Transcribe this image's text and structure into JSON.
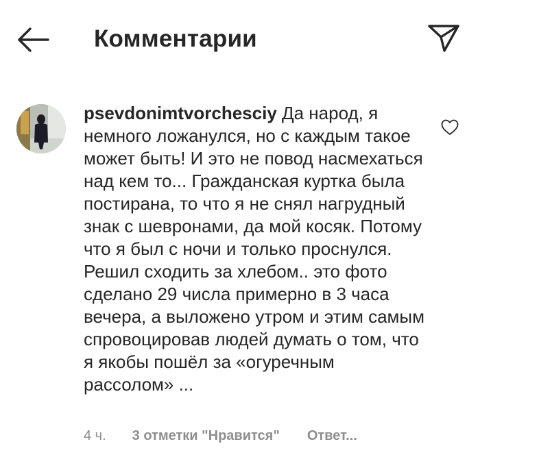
{
  "header": {
    "back_icon": "arrow-left-icon",
    "title": "Комментарии",
    "share_icon": "paper-plane-icon"
  },
  "comment": {
    "username": "psevdonimtvorchesciy",
    "text": "Да народ, я немного ложанулся, но с каждым такое может быть! И это не повод насмехаться над кем то... Гражданская куртка была постирана, то что я не снял нагрудный знак с шевронами, да мой косяк. Потому что я был с ночи и только проснулся. Решил сходить за хлебом.. это фото сделано 29 числа примерно в 3 часа вечера, а выложено утром и этим самым спровоцировав людей думать о том, что я якобы пошёл за «огуречным рассолом» ...",
    "time": "4 ч.",
    "likes": "3 отметки \"Нравится\"",
    "reply": "Ответ...",
    "like_icon": "heart-outline-icon"
  },
  "colors": {
    "text": "#262626",
    "secondary": "#8e8e8e",
    "background": "#ffffff"
  }
}
